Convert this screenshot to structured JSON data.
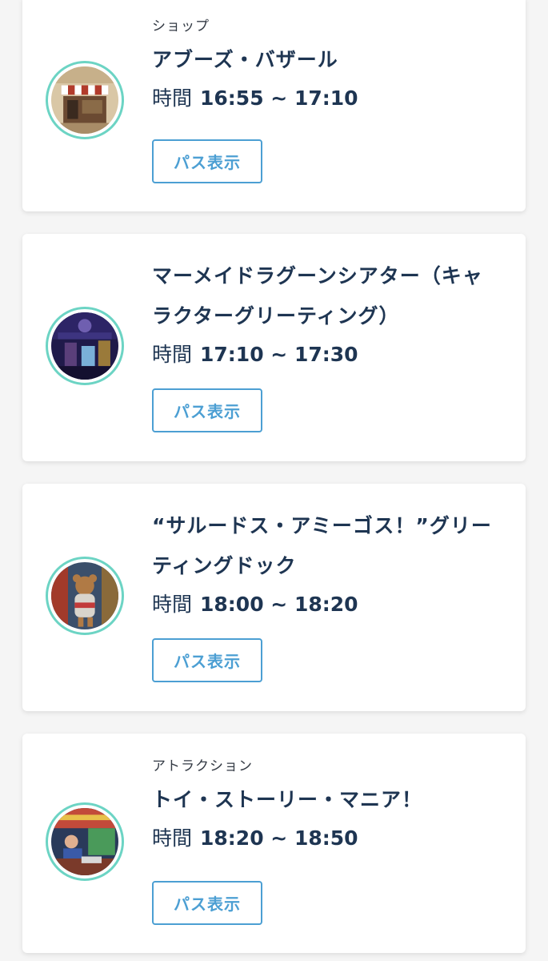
{
  "pass_list": [
    {
      "category": "ショップ",
      "name": "アブーズ・バザール",
      "time_label": "時間",
      "time_range": "16:55 ~ 17:10",
      "button_label": "パス表示",
      "thumbnail": "shop-bazaar-photo"
    },
    {
      "category": "",
      "name": "マーメイドラグーンシアター（キャラクターグリーティング）",
      "time_label": "時間",
      "time_range": "17:10 ~ 17:30",
      "button_label": "パス表示",
      "thumbnail": "mermaid-theater-photo"
    },
    {
      "category": "",
      "name": "“サルードス・アミーゴス！”グリーティングドック",
      "time_label": "時間",
      "time_range": "18:00 ~ 18:20",
      "button_label": "パス表示",
      "thumbnail": "duffy-greeting-photo"
    },
    {
      "category": "アトラクション",
      "name": "トイ・ストーリー・マニア！",
      "time_label": "時間",
      "time_range": "18:20 ~ 18:50",
      "button_label": "パス表示",
      "thumbnail": "toy-story-mania-photo"
    }
  ],
  "colors": {
    "title": "#1e3552",
    "button": "#4c9fd3",
    "thumbnail_ring": "#6cd4c4",
    "page_background": "#f5f5f5"
  }
}
